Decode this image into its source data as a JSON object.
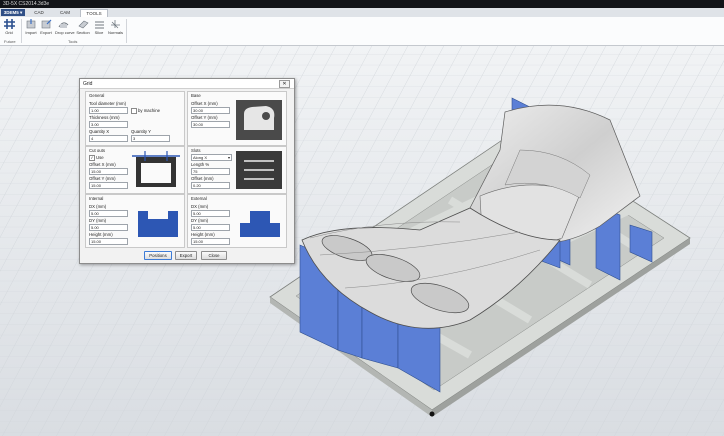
{
  "window": {
    "title": "3D-5X CS2014.3d3e"
  },
  "tabs": {
    "app_menu": "3DEM5",
    "items": [
      "CAD",
      "CAM",
      "TOOLS"
    ],
    "active": "TOOLS"
  },
  "ribbon": {
    "future_button": "Grid",
    "future_group": "Future",
    "tools": [
      "Import",
      "Export",
      "Drop curve",
      "Section",
      "Slice",
      "Normals"
    ],
    "tools_group": "Tools"
  },
  "dialog": {
    "title": "Grid",
    "close_glyph": "✕",
    "general": {
      "heading": "General",
      "tool_diameter_label": "Tool diameter (mm)",
      "tool_diameter": "1.00",
      "by_machine_label": "by machine",
      "thickness_label": "Thickness (mm)",
      "thickness": "3.00",
      "quantity_x_label": "Quantity X",
      "quantity_x": "4",
      "quantity_y_label": "Quantity Y",
      "quantity_y": "3"
    },
    "base": {
      "heading": "Base",
      "offset_x_label": "Offset X (mm)",
      "offset_x": "30.00",
      "offset_y_label": "Offset Y (mm)",
      "offset_y": "30.00"
    },
    "cutouts": {
      "heading": "Cut outs",
      "use_label": "Use",
      "use_checked": true,
      "offset_x_label": "Offset X (mm)",
      "offset_x": "15.00",
      "offset_y_label": "Offset Y (mm)",
      "offset_y": "15.00"
    },
    "slots": {
      "heading": "Slots",
      "direction": "Along X",
      "length_label": "Length %",
      "length": "75",
      "offset_label": "Offset (mm)",
      "offset": "0.20"
    },
    "internal": {
      "heading": "Internal",
      "dx_label": "DX (mm)",
      "dx": "5.00",
      "dy_label": "DY (mm)",
      "dy": "5.00",
      "height_label": "Height (mm)",
      "height": "15.00"
    },
    "external": {
      "heading": "External",
      "dx_label": "DX (mm)",
      "dx": "5.00",
      "dy_label": "DY (mm)",
      "dy": "5.00",
      "height_label": "Height (mm)",
      "height": "15.00"
    },
    "buttons": {
      "positions": "Positions",
      "export": "Export",
      "close": "Close"
    }
  },
  "colors": {
    "accent": "#2f4f86",
    "grid_part": "#5b7fd6",
    "base_plate": "#d9dcd9"
  }
}
